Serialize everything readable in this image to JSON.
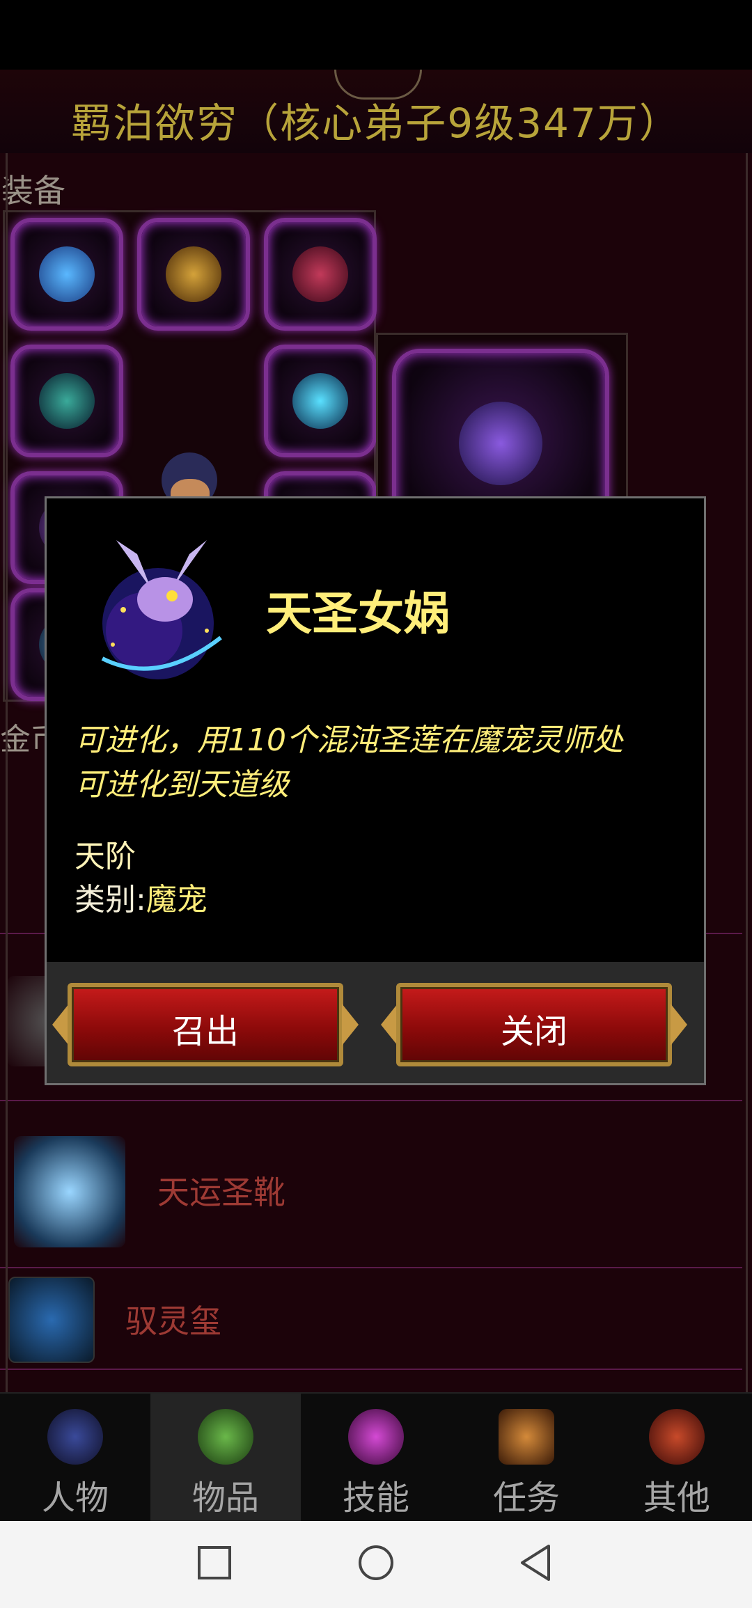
{
  "header": {
    "title": "羁泊欲穷（核心弟子9级347万）"
  },
  "equipment": {
    "section_label": "装备"
  },
  "gold_label": "金币",
  "list": [
    {
      "name": "天圣女娲"
    },
    {
      "name": "天运圣靴"
    },
    {
      "name": "驭灵玺"
    }
  ],
  "dialog": {
    "pet_name": "天圣女娲",
    "description_line1": "可进化，用110个混沌圣莲在魔宠灵师处",
    "description_line2": "可进化到天道级",
    "rank": "天阶",
    "category_key": "类别:",
    "category_value": "魔宠",
    "summon_label": "召出",
    "close_label": "关闭"
  },
  "tabs": [
    {
      "label": "人物",
      "icon": "character-icon"
    },
    {
      "label": "物品",
      "icon": "items-icon"
    },
    {
      "label": "技能",
      "icon": "skills-icon"
    },
    {
      "label": "任务",
      "icon": "tasks-icon"
    },
    {
      "label": "其他",
      "icon": "other-icon"
    }
  ],
  "active_tab": "物品",
  "colors": {
    "title_gold": "#b8a43a",
    "dialog_text": "#ffee7a",
    "button_red": "#c61b1b",
    "slot_purple": "#b43de0"
  }
}
